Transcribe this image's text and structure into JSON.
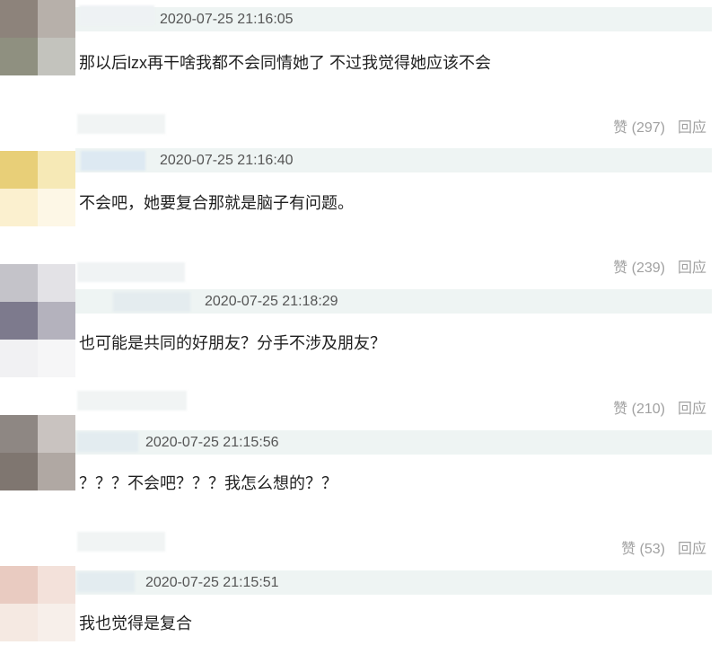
{
  "comments": [
    {
      "timestamp": "2020-07-25 21:16:05",
      "text": "那以后lzx再干啥我都不会同情她了 不过我觉得她应该不会",
      "like_label": "赞",
      "like_count": "(297)",
      "reply_label": "回应"
    },
    {
      "timestamp": "2020-07-25 21:16:40",
      "text": "不会吧，她要复合那就是脑子有问题。",
      "like_label": "赞",
      "like_count": "(239)",
      "reply_label": "回应"
    },
    {
      "timestamp": "2020-07-25 21:18:29",
      "text": "也可能是共同的好朋友？分手不涉及朋友？",
      "like_label": "赞",
      "like_count": "(210)",
      "reply_label": "回应"
    },
    {
      "timestamp": "2020-07-25 21:15:56",
      "text": "？？？不会吧？？？我怎么想的？？",
      "like_label": "赞",
      "like_count": "(53)",
      "reply_label": "回应"
    },
    {
      "timestamp": "2020-07-25 21:15:51",
      "text": "我也觉得是复合",
      "like_label": "",
      "like_count": "",
      "reply_label": ""
    }
  ],
  "colors": {
    "meta_band": "#eef4f3",
    "action_text": "#a0a0a0"
  }
}
